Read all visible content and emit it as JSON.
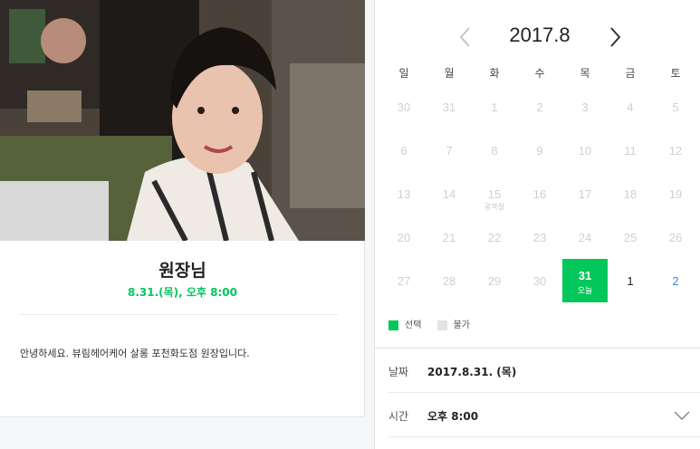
{
  "profile": {
    "name": "원장님",
    "datetime": "8.31.(목), 오후 8:00",
    "description": "안녕하세요. 뷰림헤어케어 살롱 포천화도점 원장입니다."
  },
  "calendar": {
    "title": "2017.8",
    "weekdays": [
      "일",
      "월",
      "화",
      "수",
      "목",
      "금",
      "토"
    ],
    "weeks": [
      [
        {
          "d": "30"
        },
        {
          "d": "31"
        },
        {
          "d": "1"
        },
        {
          "d": "2"
        },
        {
          "d": "3"
        },
        {
          "d": "4"
        },
        {
          "d": "5"
        }
      ],
      [
        {
          "d": "6"
        },
        {
          "d": "7"
        },
        {
          "d": "8"
        },
        {
          "d": "9"
        },
        {
          "d": "10"
        },
        {
          "d": "11"
        },
        {
          "d": "12"
        }
      ],
      [
        {
          "d": "13"
        },
        {
          "d": "14"
        },
        {
          "d": "15",
          "sub": "광복절"
        },
        {
          "d": "16"
        },
        {
          "d": "17"
        },
        {
          "d": "18"
        },
        {
          "d": "19"
        }
      ],
      [
        {
          "d": "20"
        },
        {
          "d": "21"
        },
        {
          "d": "22"
        },
        {
          "d": "23"
        },
        {
          "d": "24"
        },
        {
          "d": "25"
        },
        {
          "d": "26"
        }
      ],
      [
        {
          "d": "27"
        },
        {
          "d": "28"
        },
        {
          "d": "29"
        },
        {
          "d": "30"
        },
        {
          "d": "31",
          "sub": "오늘",
          "selected": true
        },
        {
          "d": "1",
          "active": true
        },
        {
          "d": "2",
          "active": true
        }
      ]
    ]
  },
  "legend": {
    "selected_label": "선택",
    "unavailable_label": "불가"
  },
  "details": {
    "date_label": "날짜",
    "date_value": "2017.8.31. (목)",
    "time_label": "시간",
    "time_value": "오후 8:00"
  },
  "colors": {
    "accent": "#03c75a",
    "saturday": "#3d8ad6",
    "disabled": "#d0d0d0"
  }
}
